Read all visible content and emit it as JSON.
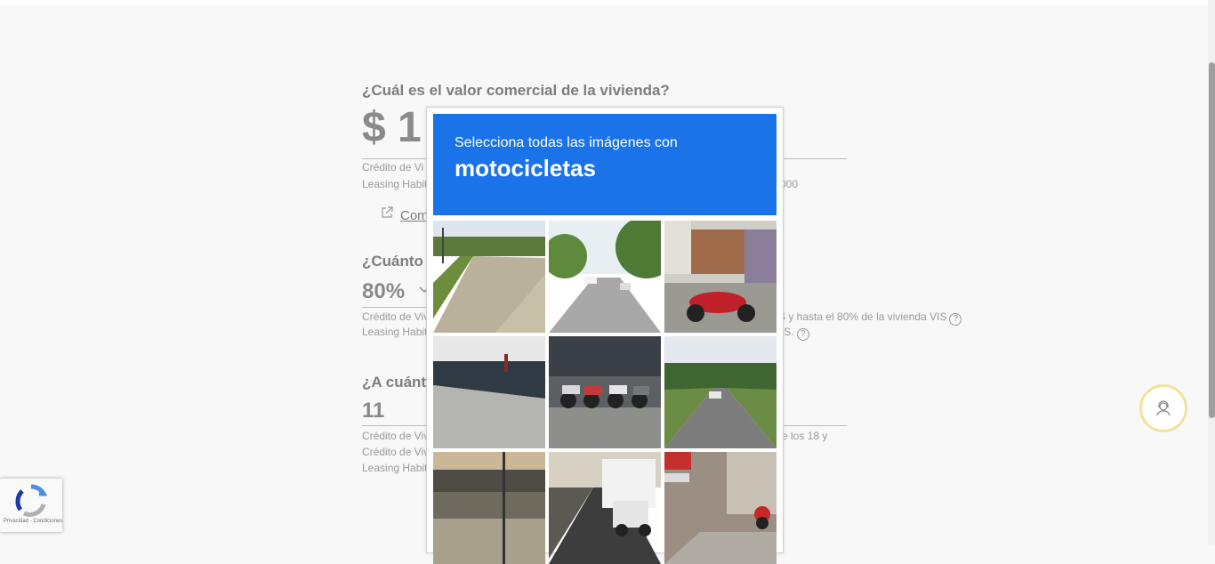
{
  "form": {
    "q1": {
      "label": "¿Cuál es el valor comercial de la vivienda?",
      "value": "$ 1",
      "note1": "Crédito de Vi",
      "note2": "Leasing Habit",
      "note2_right": "000",
      "compare_link": "Com"
    },
    "q2": {
      "label": "¿Cuánto c",
      "value": "80%",
      "note1": "Crédito de Viv",
      "note1_right": "S y hasta el 80% de la vivienda VIS",
      "note2": "Leasing Habit",
      "note2_right": "IS.",
      "help": "?"
    },
    "q3": {
      "label": "¿A cuánto",
      "value": "11",
      "note1": "Crédito de Viv",
      "note1_right": "re los 18 y",
      "note2": "Crédito de Viv",
      "note3": "Leasing Habit"
    }
  },
  "captcha": {
    "instruction": "Selecciona todas las imágenes con",
    "target": "motocicletas",
    "tiles": [
      "road-with-trees",
      "street-with-cars",
      "red-motorcycle",
      "sidewalk",
      "parked-motorcycles",
      "palm-road",
      "rail-overpass",
      "truck-on-road",
      "stop-sign-motorcycle"
    ]
  },
  "badge": {
    "text": "Privacidad - Condiciones"
  },
  "colors": {
    "captcha_header": "#1a73e8",
    "chat_ring": "#f1e39a"
  }
}
